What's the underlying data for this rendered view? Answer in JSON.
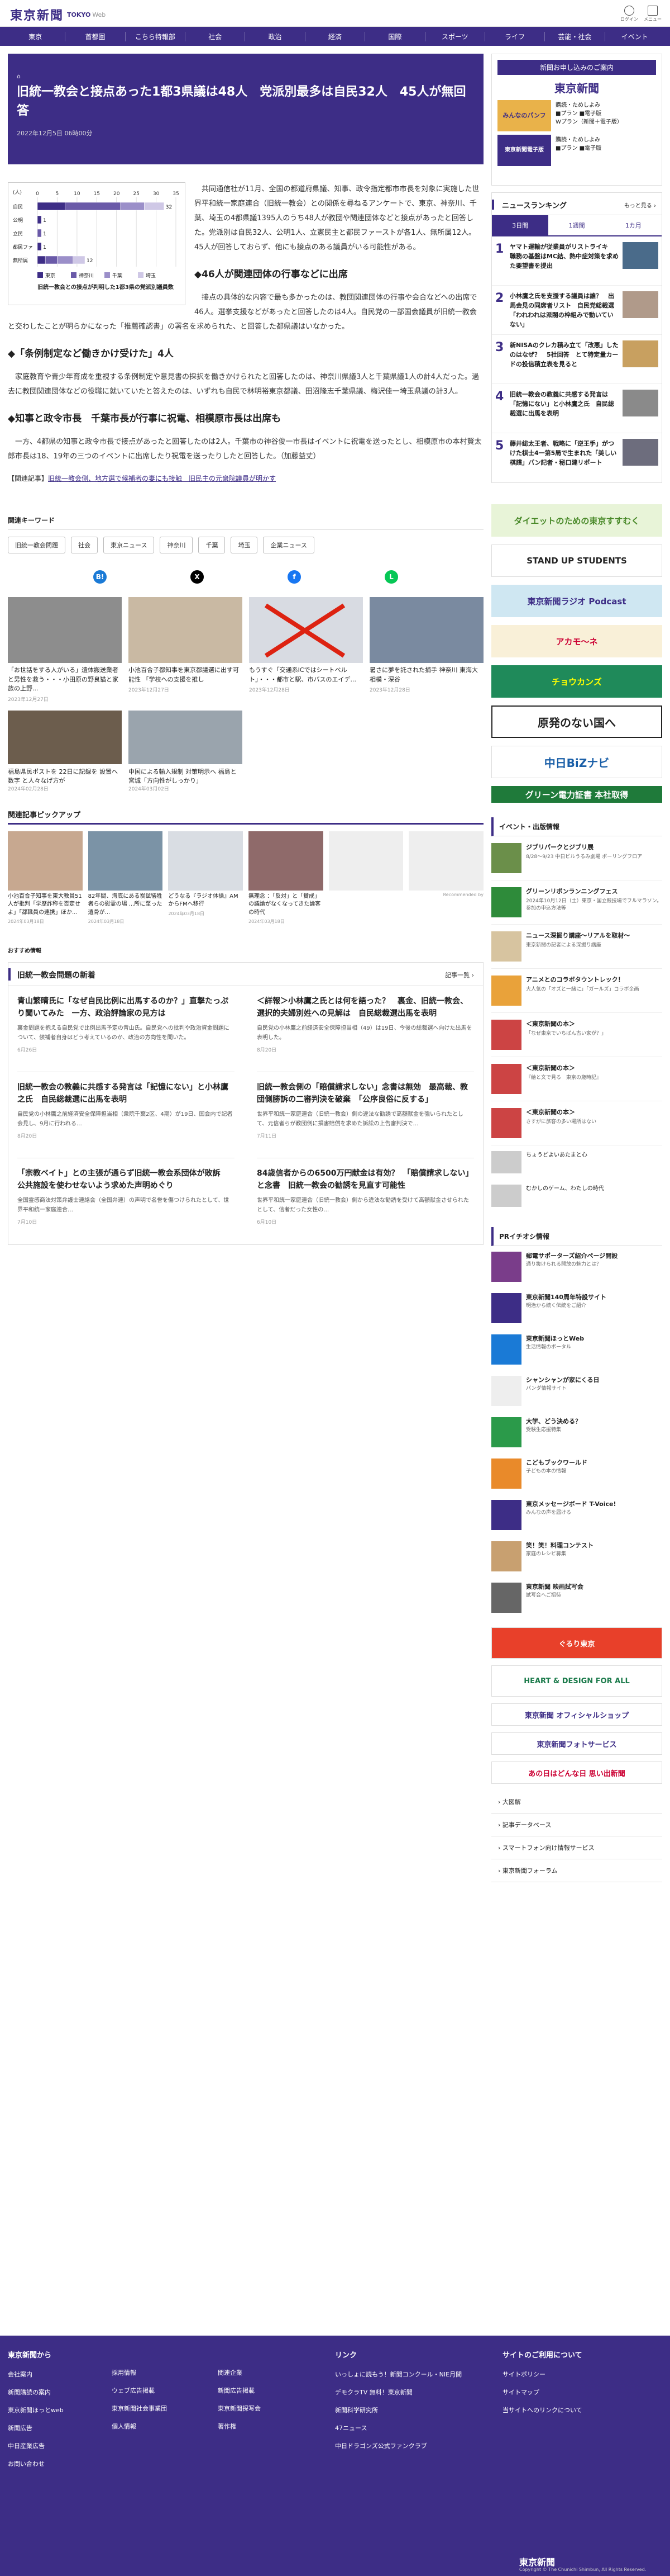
{
  "site": {
    "logo": "東京新聞",
    "sub": "TOKYO",
    "sub2": "Web",
    "top_icons": [
      "ログイン",
      "メニュー"
    ]
  },
  "nav": [
    "東京",
    "首都圏",
    "こちら特報部",
    "社会",
    "政治",
    "経済",
    "国際",
    "スポーツ",
    "ライフ",
    "芸能・社会",
    "イベント"
  ],
  "article": {
    "crumb": "⌂",
    "title": "旧統一教会と接点あった1都3県議は48人　党派別最多は自民32人　45人が無回答",
    "date": "2022年12月5日 06時00分",
    "p1": "共同通信社が11月、全国の都道府県議、知事、政令指定都市市長を対象に実施した世界平和統一家庭連合（旧統一教会）との関係を尋ねるアンケートで、東京、神奈川、千葉、埼玉の4都県議1395人のうち48人が教団や関連団体などと接点があったと回答した。党派別は自民32人、公明1人、立憲民主と都民ファーストが各1人、無所属12人。45人が回答しておらず、他にも接点のある議員がいる可能性がある。",
    "h1": "◆46人が関連団体の行事などに出席",
    "p2": "接点の具体的な内容で最も多かったのは、教団関連団体の行事や会合などへの出席で46人。選挙支援などがあったと回答したのは4人。自民党の一部国会議員が旧統一教会と交わしたことが明らかになった「推薦確認書」の署名を求められた、と回答した都県議はいなかった。",
    "h2": "◆「条例制定など働きかけ受けた」4人",
    "p3": "家庭教育や青少年育成を重視する条例制定や意見書の採択を働きかけられたと回答したのは、神奈川県議3人と千葉県議1人の計4人だった。過去に教団関連団体などの役職に就いていたと答えたのは、いずれも自民で林明裕東京都議、田沼隆志千葉県議、梅沢佳一埼玉県議の計3人。",
    "h3": "◆知事と政令市長　千葉市長が行事に祝電、相模原市長は出席も",
    "p4": "一方、4都県の知事と政令市長で接点があったと回答したのは2人。千葉市の神谷俊一市長はイベントに祝電を送ったとし、相模原市の本村賢太郎市長は18、19年の三つのイベントに出席したり祝電を送ったりしたと回答した。（加藤益丈）",
    "related_label": "【関連記事】",
    "related_link": "旧統一教会側、地方選で候補者の妻にも接触　旧民主の元衆院議員が明かす"
  },
  "chart_data": {
    "type": "bar",
    "title": "旧統一教会との接点が判明した1都3県の党派別議員数",
    "xlabel": "(人)",
    "categories": [
      "自民",
      "公明",
      "立民",
      "都民ファ",
      "無所属"
    ],
    "series": [
      {
        "name": "東京",
        "values": [
          7,
          1,
          0,
          1,
          2
        ]
      },
      {
        "name": "神奈川",
        "values": [
          14,
          0,
          1,
          0,
          3
        ]
      },
      {
        "name": "千葉",
        "values": [
          6,
          0,
          0,
          0,
          4
        ]
      },
      {
        "name": "埼玉",
        "values": [
          5,
          0,
          0,
          0,
          3
        ]
      }
    ],
    "xticks": [
      "0",
      "5",
      "10",
      "15",
      "20",
      "25",
      "30",
      "35"
    ],
    "xlim": [
      0,
      35
    ],
    "totals": [
      32,
      1,
      1,
      1,
      12
    ],
    "colors": [
      "#3d2d86",
      "#6a5aa8",
      "#9b8fc9",
      "#cfc8e6"
    ]
  },
  "keywords": {
    "heading": "関連キーワード",
    "items": [
      "旧統一教会問題",
      "社会",
      "東京ニュース",
      "神奈川",
      "千葉",
      "埼玉",
      "企業ニュース"
    ]
  },
  "share": [
    "B!",
    "X",
    "f",
    "L"
  ],
  "news_cards": [
    {
      "t": "「お世話をする人がいる」遺体搬送業者と男性を救う・・・小田原の野良猫と家族の上野...",
      "d": "2023年12月27日"
    },
    {
      "t": "小池百合子都知事を東京都議選に出す可能性 「学校への支援を推し",
      "d": "2023年12月27日"
    },
    {
      "t": "もうすぐ「交通系ICではシートベルト」・・・都市と駅、市バスのエイデ...",
      "d": "2023年12月28日"
    },
    {
      "t": "暑さに夢を託された捕手 神奈川 東海大相模・深谷",
      "d": "2023年12月28日"
    }
  ],
  "news_cards2": [
    {
      "t": "福島県民ポストを 22日に記録を 設置へ 数字 と人々なげ方が",
      "d": "2024年02月28日"
    },
    {
      "t": "中国による輸入規制 対策明示へ 福島と宮城「方向性がしっかり」",
      "d": "2024年03月02日"
    }
  ],
  "pickup": {
    "heading": "関連記事ピックアップ",
    "items": [
      {
        "t": "小池百合子知事を東大教員51人が批判「学歴詐称を否定せよ」「都職員の連携」ほか...",
        "d": "2024年03月18日"
      },
      {
        "t": "82年間、海底にある炭鉱犠牲者らの慰霊の場 ...所に至った遺骨が...",
        "d": "2024年03月18日"
      },
      {
        "t": "どうなる『ラジオ体操』AMからFMへ移行",
        "d": "2024年03月18日"
      },
      {
        "t": "無理念 ：「反対」と「賛成」の議論がなくなってきた論客の時代",
        "d": "2024年03月18日"
      },
      {
        "t": "",
        "d": ""
      },
      {
        "t": "",
        "d": ""
      }
    ],
    "recommend": "Recommended by"
  },
  "osusume": "おすすめ情報",
  "latest": {
    "heading": "旧統一教会問題の新着",
    "more": "記事一覧 ›",
    "items": [
      {
        "t": "青山繁晴氏に「なぜ自民比例に出馬するのか？」直撃たっぷり聞いてみた　一方、政治評論家の見方は",
        "s": "裏金問題を抱える自民党で比例出馬予定の青山氏。自民党への批判や政治資金問題について、候補者自身はどう考えているのか、政治の方向性を聞いた。",
        "d": "6月26日"
      },
      {
        "t": "＜詳報＞小林鷹之氏とは何を語った？　裏金、旧統一教会、選択的夫婦別姓への見解は　自民総裁選出馬を表明",
        "s": "自民党の小林鷹之前経済安全保障担当相（49）は19日、今後の総裁選へ向けた出馬を表明した。",
        "d": "8月20日"
      },
      {
        "t": "旧統一教会の教義に共感する発言は「記憶にない」と小林鷹之氏　自民総裁選に出馬を表明",
        "s": "自民党の小林鷹之前経済安全保障担当相（衆院千葉2区、4期）が19日、国会内で記者会見し、9月に行われる…",
        "d": "8月20日"
      },
      {
        "t": "旧統一教会側の「賠償請求しない」念書は無効　最高裁、教団側勝訴の二審判決を破棄　「公序良俗に反する」",
        "s": "世界平和統一家庭連合（旧統一教会）側の違法な勧誘で高額献金を強いられたとして、元信者らが教団側に損害賠償を求めた訴訟の上告審判決で…",
        "d": "7月11日"
      },
      {
        "t": "「宗教ベイト」との主張が通らず旧統一教会系団体が敗訴　公共施設を使わせないよう求めた声明めぐり",
        "s": "全国霊感商法対策弁護士連絡会（全国弁連）の声明で名誉を傷つけられたとして、世界平和統一家庭連合…",
        "d": "7月10日"
      },
      {
        "t": "84歳信者からの6500万円献金は有効？　「賠償請求しない」と念書　旧統一教会の勧誘を見直す可能性",
        "s": "世界平和統一家庭連合（旧統一教会）側から違法な勧誘を受けて高額献金させられたとして、信者だった女性の…",
        "d": "6月10日"
      }
    ]
  },
  "side": {
    "ad_heading": "新聞お申し込みのご案内",
    "ad_logo": "東京新聞",
    "ad_rows": [
      {
        "img": "みんなのパンフ",
        "lines": [
          "購読・ためしよみ",
          "■プラン  ■電子版",
          "Wプラン（新聞＋電子版）"
        ]
      },
      {
        "img": "東京新聞電子版",
        "lines": [
          "購読・ためしよみ",
          "■プラン  ■電子版"
        ]
      }
    ],
    "rank_heading": "ニュースランキング",
    "rank_more": "もっと見る ›",
    "tabs": [
      "3日間",
      "1週間",
      "1カ月"
    ],
    "ranking": [
      {
        "n": "1",
        "t": "ヤマト運輸が従業員がリストライキ　職務の基盤はMC結、熱中症対策を求めた要望書を提出"
      },
      {
        "n": "2",
        "t": "小林鷹之氏を支援する議員は誰？　出馬会見の同席者リスト　自民党総裁選「われわれは派閥の枠組みで動いていない」"
      },
      {
        "n": "3",
        "t": "新NISAのクレカ積み立て「改悪」したのはなぜ？　5社回答　とて特定量カードの投信積立表を見ると"
      },
      {
        "n": "4",
        "t": "旧統一教会の教義に共感する発言は「記憶にない」と小林鷹之氏　自民総裁選に出馬を表明"
      },
      {
        "n": "5",
        "t": "藤井総太王者、戦略に「逆王手」がつけた棋士4一第5局で生まれた「美しい棋譜」パン記者・秘口建リポート"
      }
    ],
    "banners": [
      "ダイエットのための東京すすむく",
      "STAND UP STUDENTS",
      "東京新聞ラジオ Podcast",
      "アカモ〜ネ",
      "チョウカンズ",
      "原発のない国へ",
      "中日BiZナビ",
      "グリーン電力証書 本社取得"
    ],
    "event_heading": "イベント・出版情報",
    "events": [
      {
        "t": "ジブリパークとジブリ展",
        "s": "8/28〜9/23 中日ビルうるみ劇場 ボーリングフロア"
      },
      {
        "t": "グリーンリボンランニングフェス",
        "s": "2024年10月12日（土）東京・国立競技場でフルマラソン。参加の申込方法等"
      },
      {
        "t": "ニュース深掘り講座〜リアルを取材〜",
        "s": "東京新聞の記者による深掘り講座"
      },
      {
        "t": "アニメとのコラボタウントレック！",
        "s": "大人気の「オズと一緒に」「ガールズ」コラボ企画"
      },
      {
        "t": "＜東京新聞の本＞",
        "s": "「なぜ東京でいちばん古い家が？」"
      },
      {
        "t": "＜東京新聞の本＞",
        "s": "『絵と文で見る　東京の歳時記』"
      },
      {
        "t": "＜東京新聞の本＞",
        "s": "さすがに旅客の多い場所はない"
      }
    ],
    "events_extra": [
      "ちょうどよいあたまと心",
      "むかしのゲーム、わたしの時代"
    ],
    "pr_heading": "PRイチオシ情報",
    "pr": [
      {
        "t": "郵電サポーターズ紹介ページ開設",
        "s": "通り抜けられる開放の魅力とは？"
      },
      {
        "t": "東京新聞140周年特設サイト",
        "s": "明治から続く伝統をご紹介"
      },
      {
        "t": "東京新聞ほっとWeb",
        "s": "生活情報のポータル"
      },
      {
        "t": "シャンシャンが家にくる日",
        "s": "パンダ情報サイト"
      },
      {
        "t": "大学、どう決める？",
        "s": "受験生応援特集"
      },
      {
        "t": "こどもブックワールド",
        "s": "子どもの本の情報"
      },
      {
        "t": "東京メッセージボード T-Voice!",
        "s": "みんなの声を届ける"
      },
      {
        "t": "笑！笑！料理コンテスト",
        "s": "家庭のレシピ募集"
      },
      {
        "t": "東京新聞 映画試写会",
        "s": "試写会へご招待"
      }
    ],
    "sbanners": [
      "ぐるり東京",
      "HEART & DESIGN FOR ALL",
      "東京新聞 オフィシャルショップ",
      "東京新聞フォトサービス",
      "あの日はどんな日 思い出新聞"
    ],
    "slinks": [
      "› 大図解",
      "› 記事データベース",
      "› スマートフォン向け情報サービス",
      "› 東京新聞フォーラム"
    ]
  },
  "footer": {
    "col1_h": "東京新聞から",
    "col1": [
      "会社案内",
      "新聞購読の案内",
      "東京新聞ほっとweb",
      "新聞広告",
      "中日産業広告",
      "お問い合わせ"
    ],
    "col2": [
      "採用情報",
      "ウェブ広告掲載",
      "東京新聞社会事業団",
      "個人情報"
    ],
    "col3": [
      "関連企業",
      "新聞広告掲載",
      "東京新聞探写会",
      "著作権"
    ],
    "col4_h": "リンク",
    "col4": [
      "いっしょに読もう！新聞コンクール・NIE月間",
      "デモクラTV 無料！東京新聞",
      "新聞科学研究所",
      "47ニュース",
      "中日ドラゴンズ公式ファンクラブ"
    ],
    "col5_h": "サイトのご利用について",
    "col5": [
      "サイトポリシー",
      "サイトマップ",
      "当サイトへのリンクについて"
    ],
    "logo": "東京新聞",
    "copy": "Copyright © The Chunichi Shimbun, All Rights Reserved."
  }
}
